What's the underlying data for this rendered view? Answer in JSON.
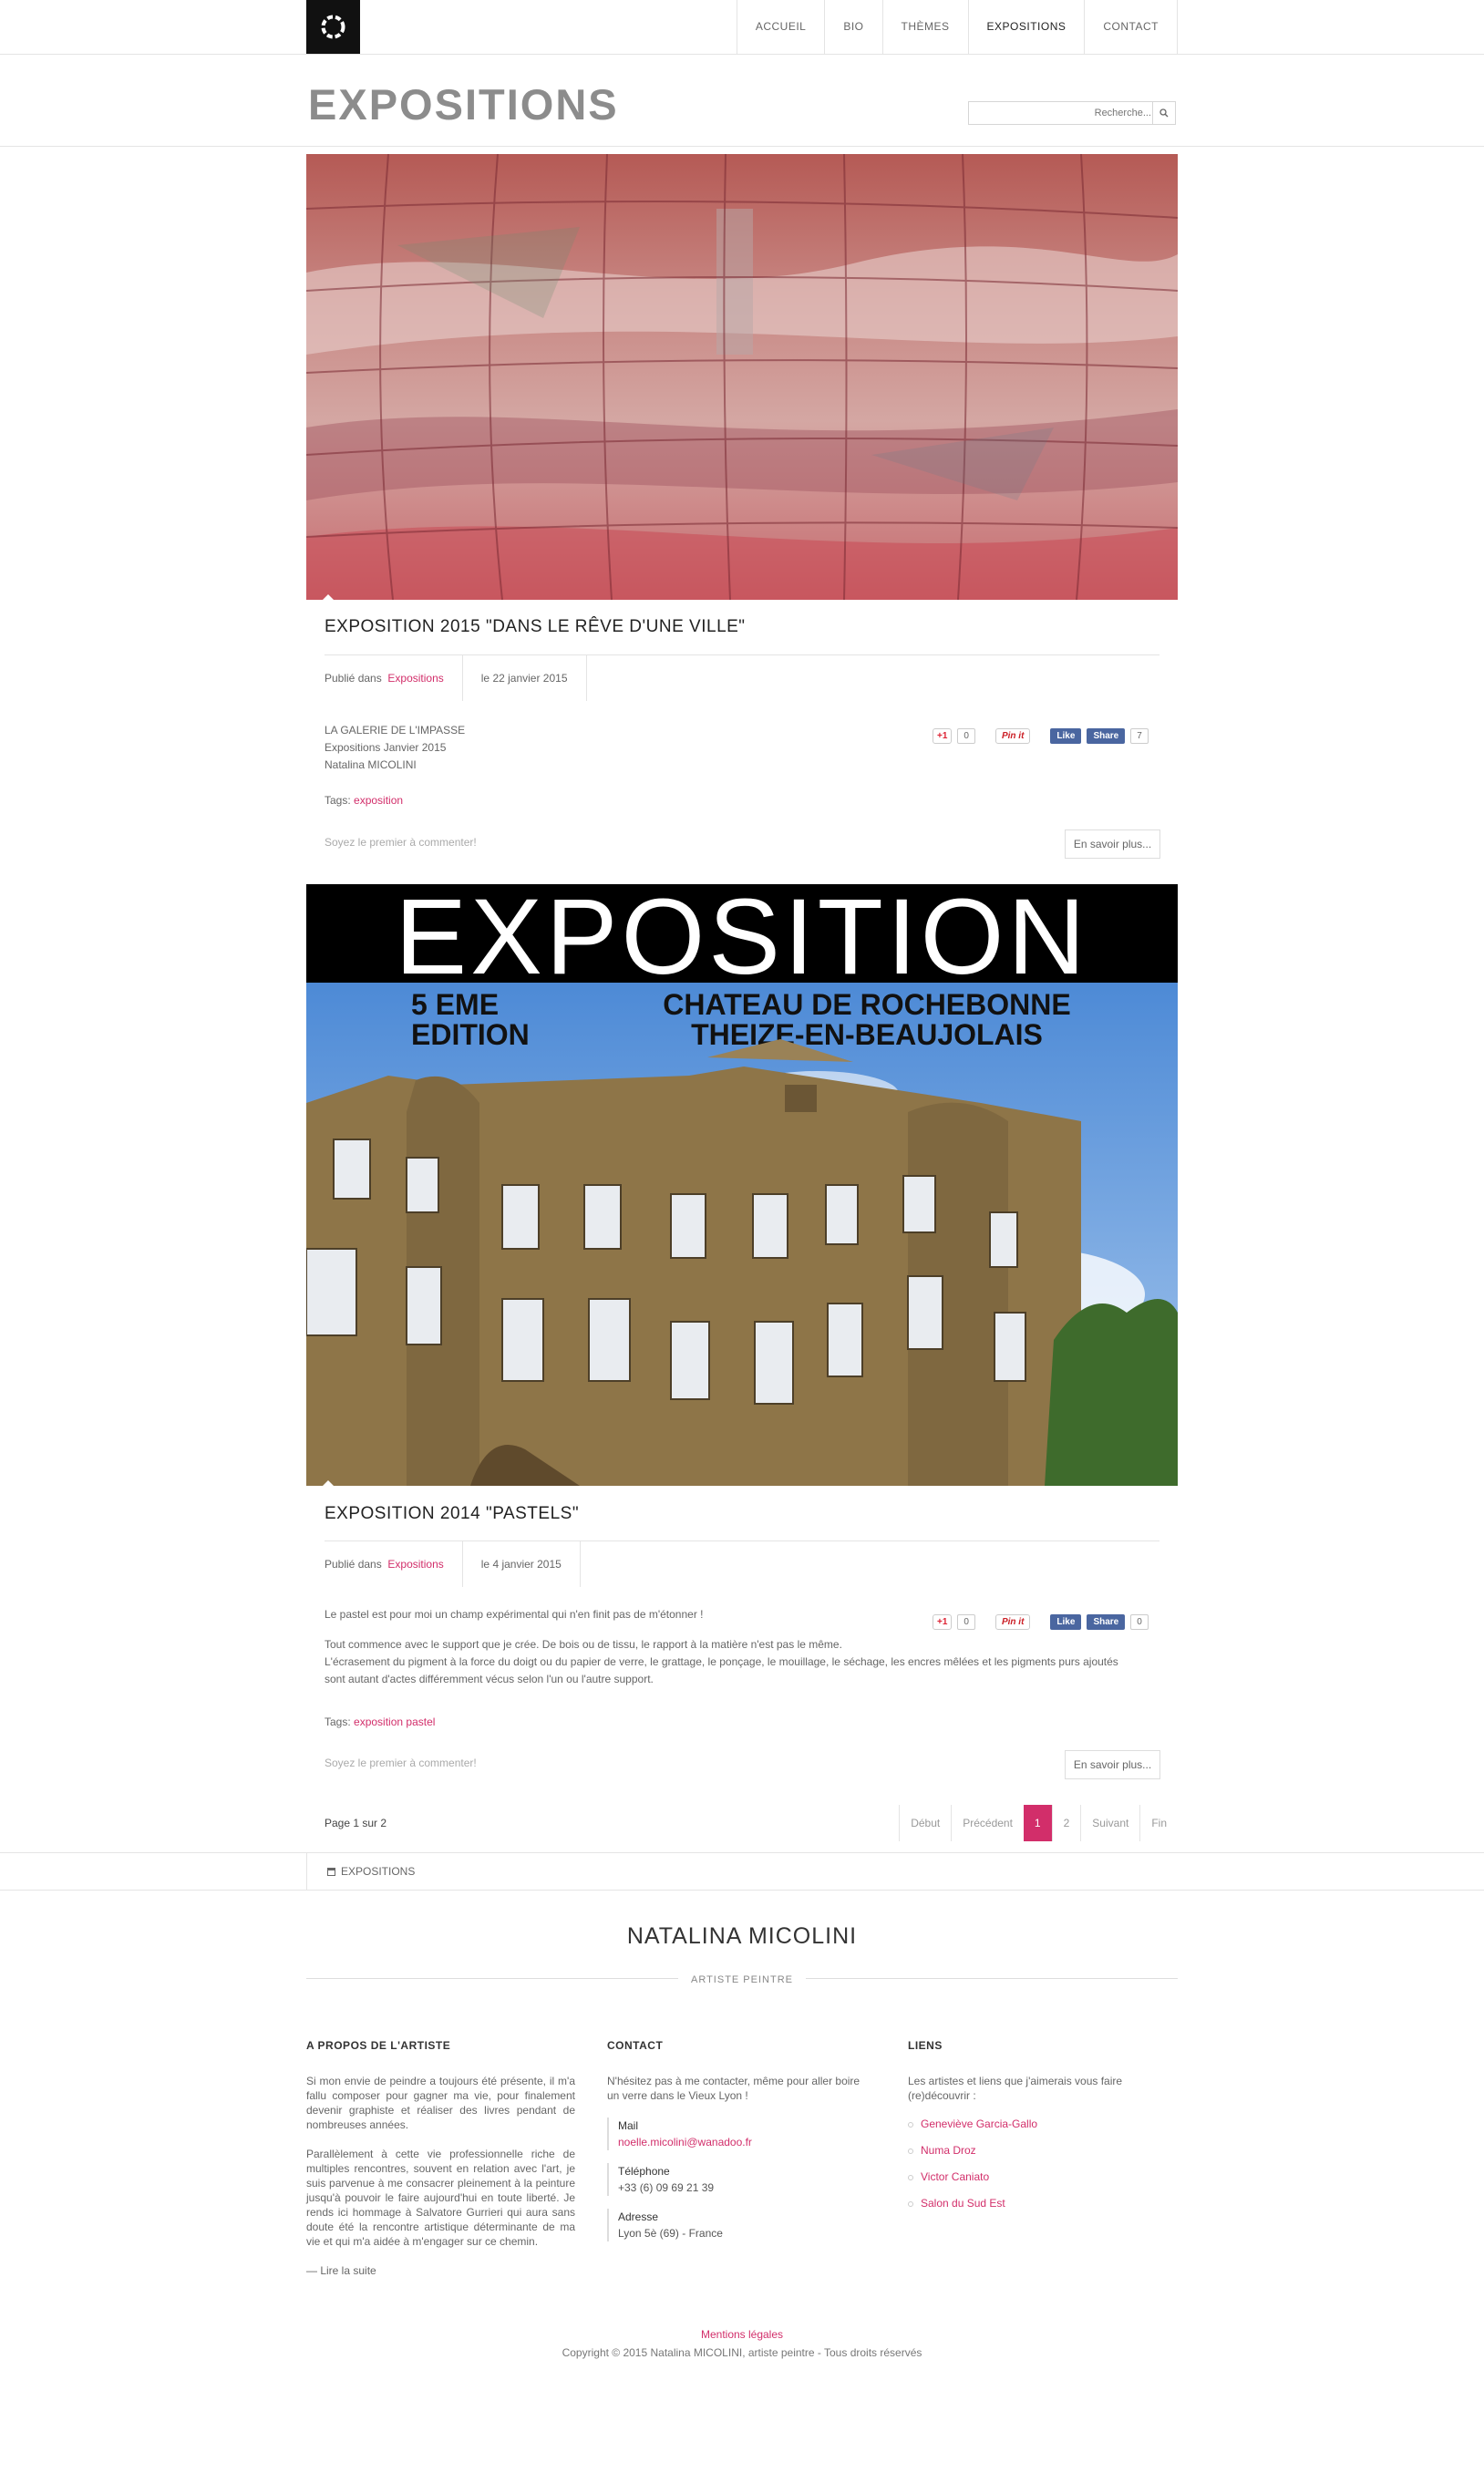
{
  "nav": {
    "items": [
      {
        "label": "ACCUEIL"
      },
      {
        "label": "BIO"
      },
      {
        "label": "THÈMES"
      },
      {
        "label": "EXPOSITIONS"
      },
      {
        "label": "CONTACT"
      }
    ]
  },
  "page": {
    "title": "EXPOSITIONS",
    "search_placeholder": "Recherche..."
  },
  "articles": [
    {
      "title": "EXPOSITION 2015 \"DANS LE RÊVE D'UNE VILLE\"",
      "published_label": "Publié dans",
      "category": "Expositions",
      "date": "le 22 janvier 2015",
      "body": [
        "LA GALERIE DE L'IMPASSE",
        "Expositions Janvier 2015",
        "Natalina MICOLINI"
      ],
      "tags_label": "Tags:",
      "tags": [
        "exposition"
      ],
      "comment_text": "Soyez le premier à commenter!",
      "more_label": "En savoir plus...",
      "social": {
        "gplus": "+1",
        "gplus_count": "0",
        "pin": "Pin it",
        "like": "Like",
        "share": "Share",
        "share_count": "7"
      }
    },
    {
      "title": "EXPOSITION 2014 \"PASTELS\"",
      "published_label": "Publié dans",
      "category": "Expositions",
      "date": "le 4 janvier 2015",
      "body": [
        "Le pastel est pour moi un champ expérimental qui n'en finit pas de m'étonner !",
        "Tout commence avec le support que je crée. De bois ou de tissu, le rapport à la matière n'est pas le même.",
        "L'écrasement du pigment à la force du doigt ou du papier de verre, le grattage, le ponçage, le mouillage, le séchage, les encres mêlées et les pigments purs ajoutés",
        "sont autant d'actes différemment vécus selon l'un ou l'autre support."
      ],
      "tags_label": "Tags:",
      "tags": [
        "exposition",
        "pastel"
      ],
      "comment_text": "Soyez le premier à commenter!",
      "more_label": "En savoir plus...",
      "poster": {
        "headline": "EXPOSITION",
        "edition": "5 EME\nEDITION",
        "place": "CHATEAU DE ROCHEBONNE\nTHEIZE-EN-BEAUJOLAIS"
      },
      "social": {
        "gplus": "+1",
        "gplus_count": "0",
        "pin": "Pin it",
        "like": "Like",
        "share": "Share",
        "share_count": "0"
      }
    }
  ],
  "pagination": {
    "page_of": "Page 1 sur 2",
    "items": [
      "Début",
      "Précédent",
      "1",
      "2",
      "Suivant",
      "Fin"
    ],
    "current": "1"
  },
  "breadcrumb": {
    "label": "EXPOSITIONS"
  },
  "footer": {
    "name": "NATALINA MICOLINI",
    "subtitle": "ARTISTE PEINTRE",
    "about": {
      "title": "A PROPOS DE L'ARTISTE",
      "p1": "Si mon envie de peindre a toujours été présente, il m'a fallu composer pour gagner ma vie, pour finalement devenir graphiste et réaliser des livres pendant de nombreuses années.",
      "p2": "Parallèlement à cette vie professionnelle riche de multiples rencontres, souvent en relation avec l'art, je suis parvenue à me consacrer pleinement à la peinture jusqu'à pouvoir le faire aujourd'hui en toute liberté. Je rends ici hommage à Salvatore Gurrieri qui aura sans doute été la rencontre artistique déterminante de ma vie et qui m'a aidée à m'engager sur ce chemin.",
      "read_more": "— Lire la suite"
    },
    "contact": {
      "title": "CONTACT",
      "intro": "N'hésitez pas à me contacter, même pour aller boire un verre dans le Vieux Lyon !",
      "mail_label": "Mail",
      "mail": "noelle.micolini@wanadoo.fr",
      "phone_label": "Téléphone",
      "phone": "+33 (6) 09 69 21 39",
      "address_label": "Adresse",
      "address": "Lyon 5è (69) - France"
    },
    "links": {
      "title": "LIENS",
      "intro": "Les artistes et liens que j'aimerais vous faire (re)découvrir :",
      "items": [
        "Geneviève Garcia-Gallo",
        "Numa Droz",
        "Victor Caniato",
        "Salon du Sud Est"
      ]
    },
    "legal": "Mentions légales",
    "copyright": "Copyright © 2015 Natalina MICOLINI, artiste peintre - Tous droits réservés"
  }
}
